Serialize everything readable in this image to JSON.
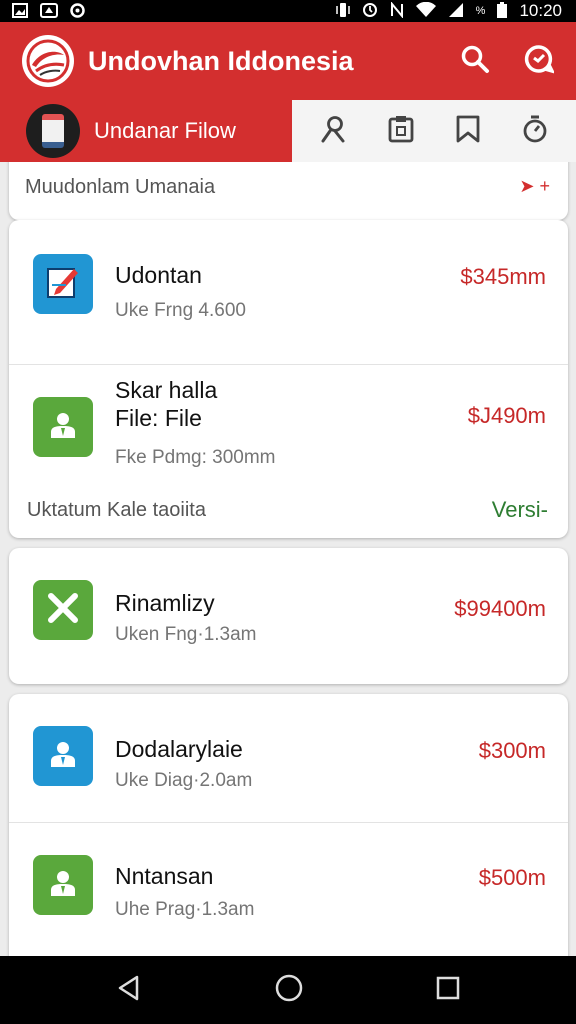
{
  "status_bar": {
    "time": "10:20",
    "battery_text": "%",
    "left_icons": [
      "image-icon",
      "cloud-icon",
      "circle-icon"
    ],
    "right_icons": [
      "vibrate-icon",
      "alarm-icon",
      "nfc-icon",
      "wifi-icon",
      "signal-icon",
      "battery-icon"
    ]
  },
  "app_bar": {
    "title": "Undovhan Iddonesia",
    "actions": [
      "search-icon",
      "chat-icon"
    ]
  },
  "sub_bar": {
    "title": "Undanar Filow",
    "tabs": [
      "person-icon",
      "clipboard-icon",
      "bookmark-icon",
      "timer-icon"
    ]
  },
  "partial_header": {
    "text": "Muudonlam Umanaia",
    "action": "➤ +"
  },
  "items": [
    {
      "title": "Udontan",
      "meta": "Uke Frng 4.600",
      "price": "$345mm",
      "icon": "edit-icon",
      "color": "blue"
    },
    {
      "title": "Skar halla",
      "title2": "File: File",
      "meta": "Fke Pdmg: 300mm",
      "price": "$J490m",
      "icon": "person-icon",
      "color": "green"
    },
    {
      "title": "Rinamlizy",
      "meta": "Uken Fng·1.3am",
      "price": "$99400m",
      "icon": "close-icon",
      "color": "green"
    },
    {
      "title": "Dodalarylaie",
      "meta": "Uke Diag·2.0am",
      "price": "$300m",
      "icon": "person-icon",
      "color": "blue"
    },
    {
      "title": "Nntansan",
      "meta": "Uhe Prag·1.3am",
      "price": "$500m",
      "icon": "person-icon",
      "color": "green"
    }
  ],
  "card_footer": {
    "left": "Uktatum Kale taoiita",
    "right": "Versi-"
  },
  "colors": {
    "primary": "#d32f2f",
    "price": "#c62828",
    "accent_green": "#2e7d32",
    "icon_blue": "#2196d3",
    "icon_green": "#5aa83c"
  },
  "nav_bar": [
    "back-icon",
    "home-icon",
    "recents-icon"
  ]
}
